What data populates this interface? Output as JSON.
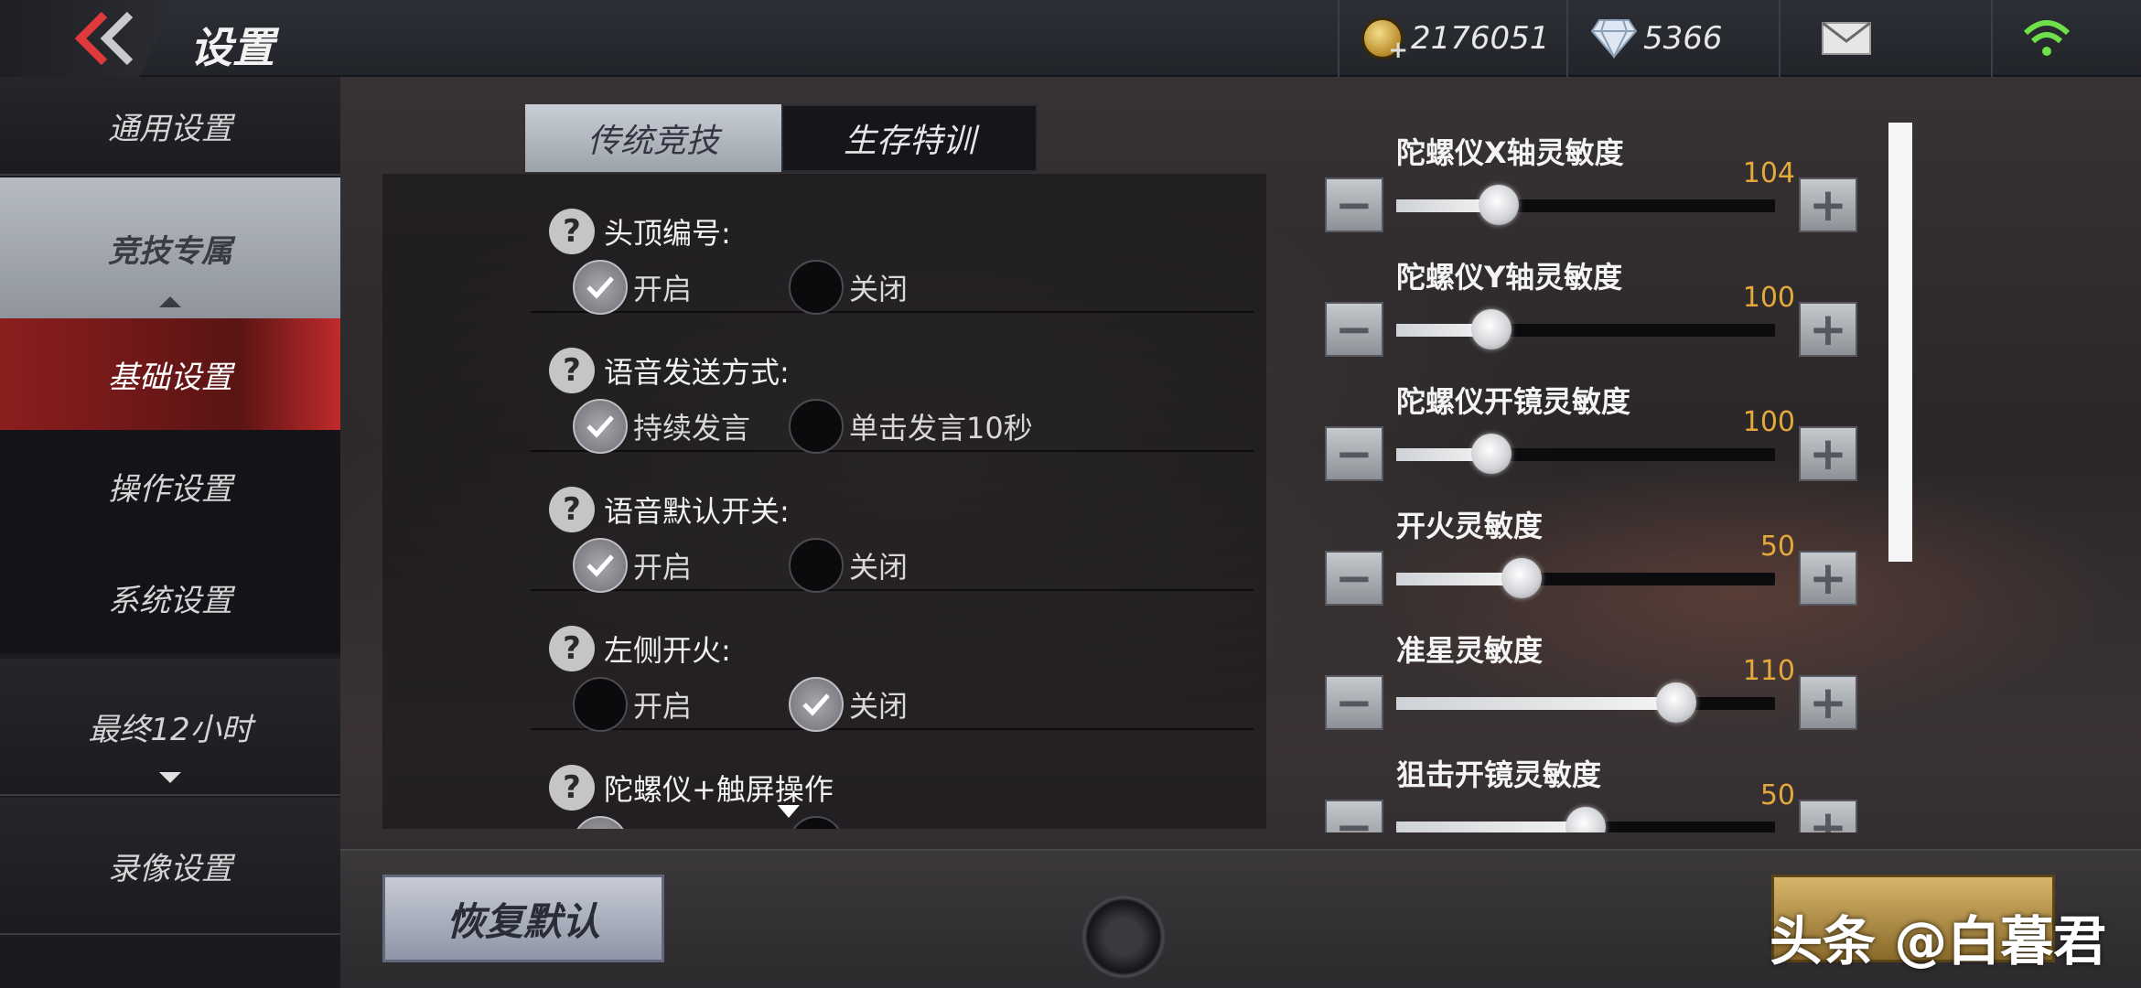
{
  "header": {
    "title": "设置",
    "gold": "2176051",
    "diamonds": "5366"
  },
  "sidebar": {
    "items": [
      {
        "label": "通用设置"
      },
      {
        "label": "竞技专属"
      },
      {
        "label": "基础设置"
      },
      {
        "label": "操作设置"
      },
      {
        "label": "系统设置"
      },
      {
        "label": "最终12小时"
      },
      {
        "label": "录像设置"
      }
    ]
  },
  "mode_tabs": [
    {
      "label": "传统竞技",
      "active": true
    },
    {
      "label": "生存特训",
      "active": false
    }
  ],
  "options": [
    {
      "label": "头顶编号:",
      "choices": [
        "开启",
        "关闭"
      ],
      "selected": 0
    },
    {
      "label": "语音发送方式:",
      "choices": [
        "持续发言",
        "单击发言10秒"
      ],
      "selected": 0
    },
    {
      "label": "语音默认开关:",
      "choices": [
        "开启",
        "关闭"
      ],
      "selected": 0
    },
    {
      "label": "左侧开火:",
      "choices": [
        "开启",
        "关闭"
      ],
      "selected": 1
    },
    {
      "label": "陀螺仪+触屏操作",
      "choices": [],
      "selected": null
    }
  ],
  "sliders": [
    {
      "label": "陀螺仪X轴灵敏度",
      "value": "104",
      "fraction": 0.27
    },
    {
      "label": "陀螺仪Y轴灵敏度",
      "value": "100",
      "fraction": 0.25
    },
    {
      "label": "陀螺仪开镜灵敏度",
      "value": "100",
      "fraction": 0.25
    },
    {
      "label": "开火灵敏度",
      "value": "50",
      "fraction": 0.33
    },
    {
      "label": "准星灵敏度",
      "value": "110",
      "fraction": 0.74
    },
    {
      "label": "狙击开镜灵敏度",
      "value": "50",
      "fraction": 0.5
    }
  ],
  "footer": {
    "restore_label": "恢复默认",
    "watermark": "头条 @白暮君"
  },
  "colors": {
    "accent_red": "#8c1e1e",
    "value_gold": "#e5a93a",
    "wifi_green": "#6fe04a"
  }
}
